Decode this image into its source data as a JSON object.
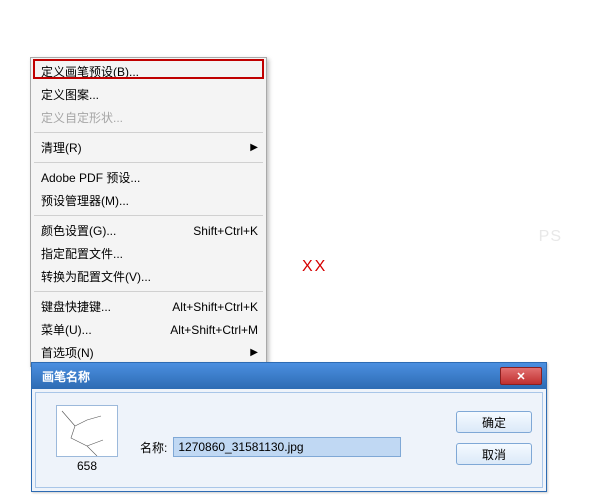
{
  "menu": {
    "items": [
      {
        "label": "定义画笔预设(B)...",
        "disabled": false
      },
      {
        "label": "定义图案...",
        "disabled": false
      },
      {
        "label": "定义自定形状...",
        "disabled": true
      }
    ],
    "clean": {
      "label": "清理(R)"
    },
    "pdf": {
      "label": "Adobe PDF 预设..."
    },
    "preset_mgr": {
      "label": "预设管理器(M)..."
    },
    "color": {
      "label": "颜色设置(G)...",
      "shortcut": "Shift+Ctrl+K"
    },
    "profile_assign": {
      "label": "指定配置文件..."
    },
    "profile_convert": {
      "label": "转换为配置文件(V)..."
    },
    "kb": {
      "label": "键盘快捷键...",
      "shortcut": "Alt+Shift+Ctrl+K"
    },
    "menus": {
      "label": "菜单(U)...",
      "shortcut": "Alt+Shift+Ctrl+M"
    },
    "prefs": {
      "label": "首选项(N)"
    }
  },
  "xx": "XX",
  "dialog": {
    "title": "画笔名称",
    "thumb_caption": "658",
    "name_label": "名称:",
    "name_value": "1270860_31581130.jpg",
    "ok": "确定",
    "cancel": "取消"
  }
}
